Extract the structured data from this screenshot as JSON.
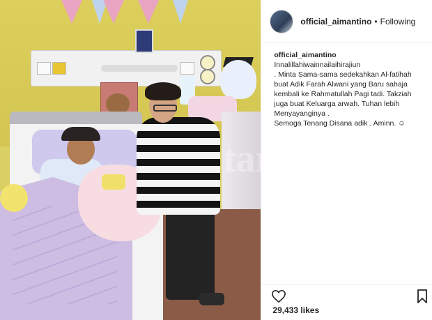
{
  "post": {
    "username": "official_aimantino",
    "separator": "•",
    "follow_status": "Following",
    "caption_user": "official_aimantino",
    "caption_lines": [
      "Innalillahiwainnailaihirajiun",
      ". Minta Sama-sama sedekahkan Al-fatihah",
      "buat Adik Farah Alwani yang Baru sahaja",
      "kembali ke Rahmatullah Pagi tadi. Takziah",
      "juga buat Keluarga arwah. Tuhan lebih",
      "Menyayanginya .",
      "Semoga Tenang Disana adik . Aminn. ☺"
    ],
    "likes": "29,433 likes",
    "watermark": "tar"
  },
  "icons": {
    "like": "heart-icon",
    "save": "bookmark-icon",
    "avatar": "avatar"
  },
  "colors": {
    "text": "#262626",
    "border": "#efefef",
    "wall": "#dccf5c"
  }
}
